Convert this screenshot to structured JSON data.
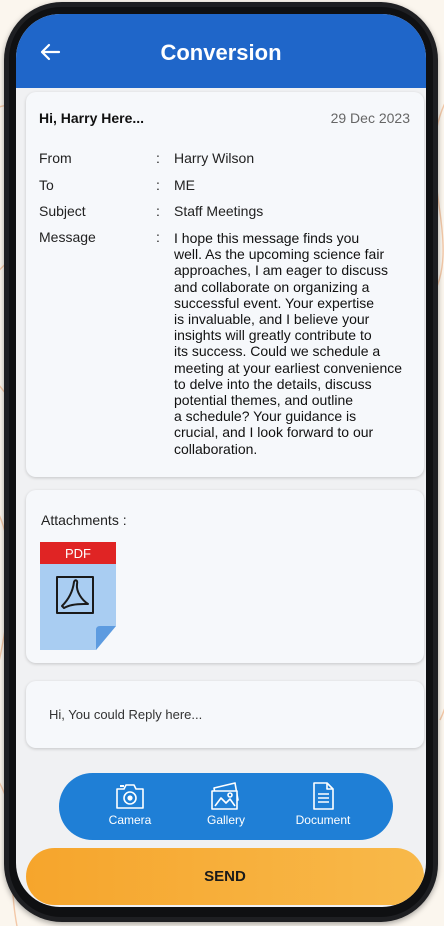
{
  "header": {
    "title": "Conversion",
    "back_icon": "back-arrow-icon"
  },
  "message": {
    "greeting": "Hi, Harry Here...",
    "date": "29 Dec 2023",
    "fields": [
      {
        "label": "From",
        "value": "Harry Wilson"
      },
      {
        "label": "To",
        "value": "ME"
      },
      {
        "label": "Subject",
        "value": "Staff Meetings"
      },
      {
        "label": "Message",
        "value": ""
      }
    ],
    "separator": ":",
    "body": "I hope this message finds you\nwell. As the upcoming science fair\napproaches, I am eager to discuss\nand collaborate on organizing a\nsuccessful event. Your expertise\nis invaluable, and I believe your\ninsights will greatly contribute to\nits success. Could we schedule a\nmeeting at your earliest convenience\nto delve into the details, discuss\npotential themes, and outline\na schedule? Your guidance is\ncrucial, and I look forward to our\ncollaboration."
  },
  "attachments": {
    "label": "Attachments :",
    "items": [
      {
        "type_label": "PDF",
        "icon": "pdf-file-icon"
      }
    ]
  },
  "reply": {
    "placeholder": "Hi, You could Reply here..."
  },
  "media_bar": {
    "buttons": [
      {
        "label": "Camera",
        "icon": "camera-icon"
      },
      {
        "label": "Gallery",
        "icon": "gallery-icon"
      },
      {
        "label": "Document",
        "icon": "document-icon"
      }
    ]
  },
  "send": {
    "label": "SEND"
  },
  "colors": {
    "header": "#1f66c9",
    "media_bar": "#1f7fd6",
    "send": "#f6a52c",
    "pdf_badge": "#e02424",
    "pdf_page": "#a9cdf2"
  }
}
